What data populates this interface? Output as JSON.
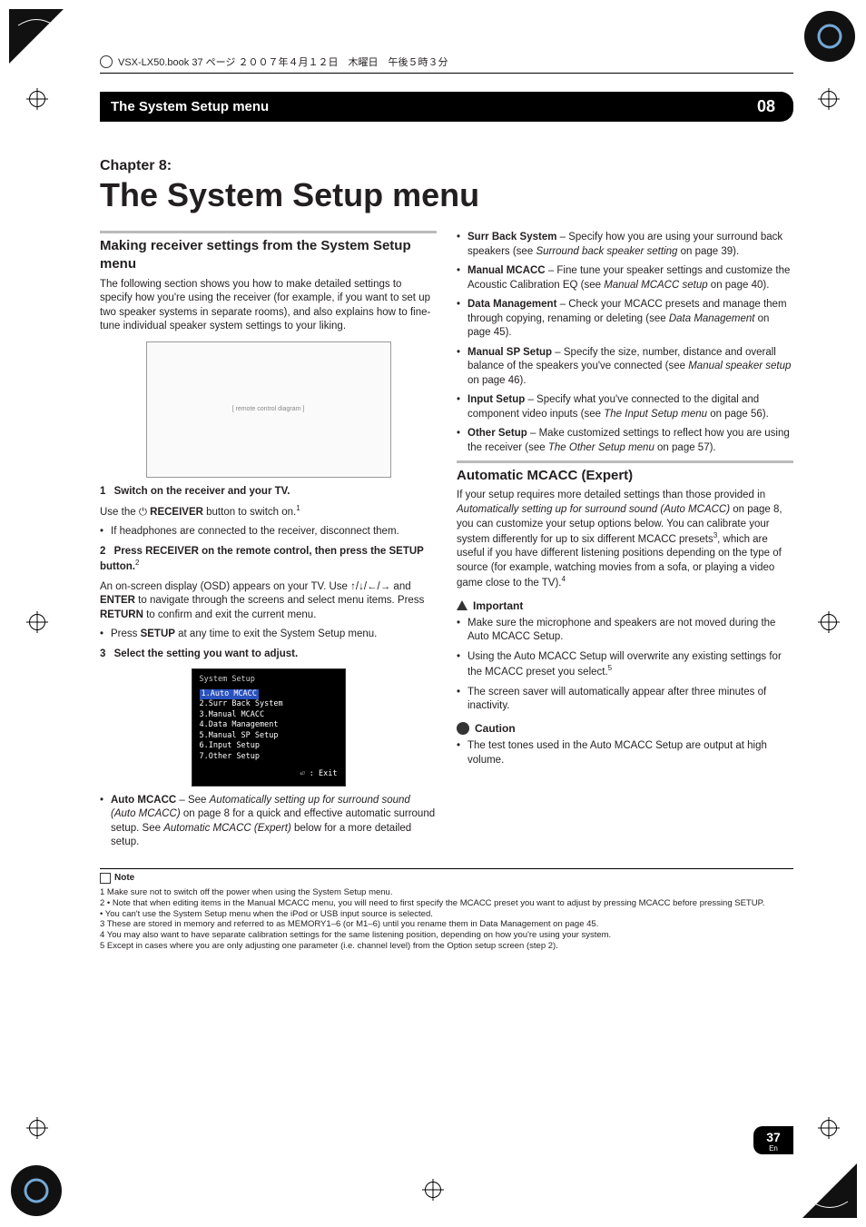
{
  "book_line": "VSX-LX50.book  37 ページ  ２００７年４月１２日　木曜日　午後５時３分",
  "header": {
    "title": "The System Setup menu",
    "num": "08"
  },
  "chapter": {
    "label": "Chapter 8:",
    "title": "The System Setup menu"
  },
  "left": {
    "h2": "Making receiver settings from the System Setup menu",
    "intro": "The following section shows you how to make detailed settings to specify how you're using the receiver (for example, if you want to set up two speaker systems in separate rooms), and also explains how to fine-tune individual speaker system settings to your liking.",
    "remote_placeholder": "[ remote control diagram ]",
    "step1_num": "1",
    "step1_bold": "Switch on the receiver and your TV.",
    "step1_line_a": "Use the ",
    "step1_line_b": " RECEIVER",
    "step1_line_c": " button to switch on.",
    "step1_sup": "1",
    "step1_bullet": "If headphones are connected to the receiver, disconnect them.",
    "step2_num": "2",
    "step2_bold_a": "Press RECEIVER on the remote control, then press the SETUP button.",
    "step2_sup": "2",
    "step2_p_a": "An on-screen display (OSD) appears on your TV. Use ",
    "step2_arrows": "↑/↓/←/→",
    "step2_p_b": " and ",
    "step2_enter": "ENTER",
    "step2_p_c": " to navigate through the screens and select menu items. Press ",
    "step2_return": "RETURN",
    "step2_p_d": " to confirm and exit the current menu.",
    "step2_bullet_a": "Press ",
    "step2_bullet_b": "SETUP",
    "step2_bullet_c": " at any time to exit the System Setup menu.",
    "step3_num": "3",
    "step3_bold": "Select the setting you want to adjust.",
    "osd": {
      "title": "System Setup",
      "items": [
        "1.Auto MCACC",
        "2.Surr Back System",
        "3.Manual MCACC",
        "4.Data Management",
        "5.Manual SP Setup",
        "6.Input Setup",
        "7.Other Setup"
      ],
      "exit": "⏎ : Exit"
    },
    "auto_mcacc_a": "Auto MCACC",
    "auto_mcacc_b": " – See ",
    "auto_mcacc_i": "Automatically setting up for surround sound (Auto MCACC)",
    "auto_mcacc_c": " on page 8 for a quick and effective automatic surround setup. See ",
    "auto_mcacc_i2": "Automatic MCACC (Expert)",
    "auto_mcacc_d": " below for a more detailed setup."
  },
  "right": {
    "bullets": [
      {
        "b": "Surr Back System",
        "t": " – Specify how you are using your surround back speakers (see ",
        "i": "Surround back speaker setting",
        "t2": " on page 39)."
      },
      {
        "b": "Manual MCACC",
        "t": " – Fine tune your speaker settings and customize the Acoustic Calibration EQ (see ",
        "i": "Manual MCACC setup",
        "t2": " on page 40)."
      },
      {
        "b": "Data Management",
        "t": " – Check your MCACC presets and manage them through copying, renaming or deleting (see ",
        "i": "Data Management",
        "t2": " on page 45)."
      },
      {
        "b": "Manual SP Setup",
        "t": " – Specify the size, number, distance and overall balance of the speakers you've connected (see ",
        "i": "Manual speaker setup",
        "t2": " on page 46)."
      },
      {
        "b": "Input Setup",
        "t": " – Specify what you've connected to the digital and component video inputs (see ",
        "i": "The Input Setup menu",
        "t2": " on page 56)."
      },
      {
        "b": "Other Setup",
        "t": " – Make customized settings to reflect how you are using the receiver (see ",
        "i": "The Other Setup menu",
        "t2": " on page 57)."
      }
    ],
    "h2": "Automatic MCACC (Expert)",
    "p1_a": "If your setup requires more detailed settings than those provided in ",
    "p1_i": "Automatically setting up for surround sound (Auto MCACC)",
    "p1_b": " on page 8, you can customize your setup options below. You can calibrate your system differently for up to six different MCACC presets",
    "p1_sup1": "3",
    "p1_c": ", which are useful if you have different listening positions depending on the type of source (for example, watching movies from a sofa, or playing a video game close to the TV).",
    "p1_sup2": "4",
    "important_lbl": "Important",
    "imp_bullets": [
      {
        "t": "Make sure the microphone and speakers are not moved during the Auto MCACC Setup."
      },
      {
        "t": "Using the Auto MCACC Setup will overwrite any existing settings for the MCACC preset you select.",
        "sup": "5"
      },
      {
        "t": "The screen saver will automatically appear after three minutes of inactivity."
      }
    ],
    "caution_lbl": "Caution",
    "caution_bullet": "The test tones used in the Auto MCACC Setup are output at high volume."
  },
  "footnotes": {
    "note_lbl": "Note",
    "lines": [
      "1 Make sure not to switch off the power when using the System Setup menu.",
      "2 • Note that when editing items in the Manual MCACC menu, you will need to first specify the MCACC preset you want to adjust by pressing MCACC before pressing SETUP.",
      "  • You can't use the System Setup menu when the iPod or USB input source is selected.",
      "3 These are stored in memory and referred to as MEMORY1–6 (or M1–6) until you rename them in Data Management on page 45.",
      "4 You may also want to have separate calibration settings for the same listening position, depending on how you're using your system.",
      "5 Except in cases where you are only adjusting one parameter (i.e. channel level) from the Option setup screen (step 2)."
    ]
  },
  "page_num": {
    "n": "37",
    "en": "En"
  }
}
